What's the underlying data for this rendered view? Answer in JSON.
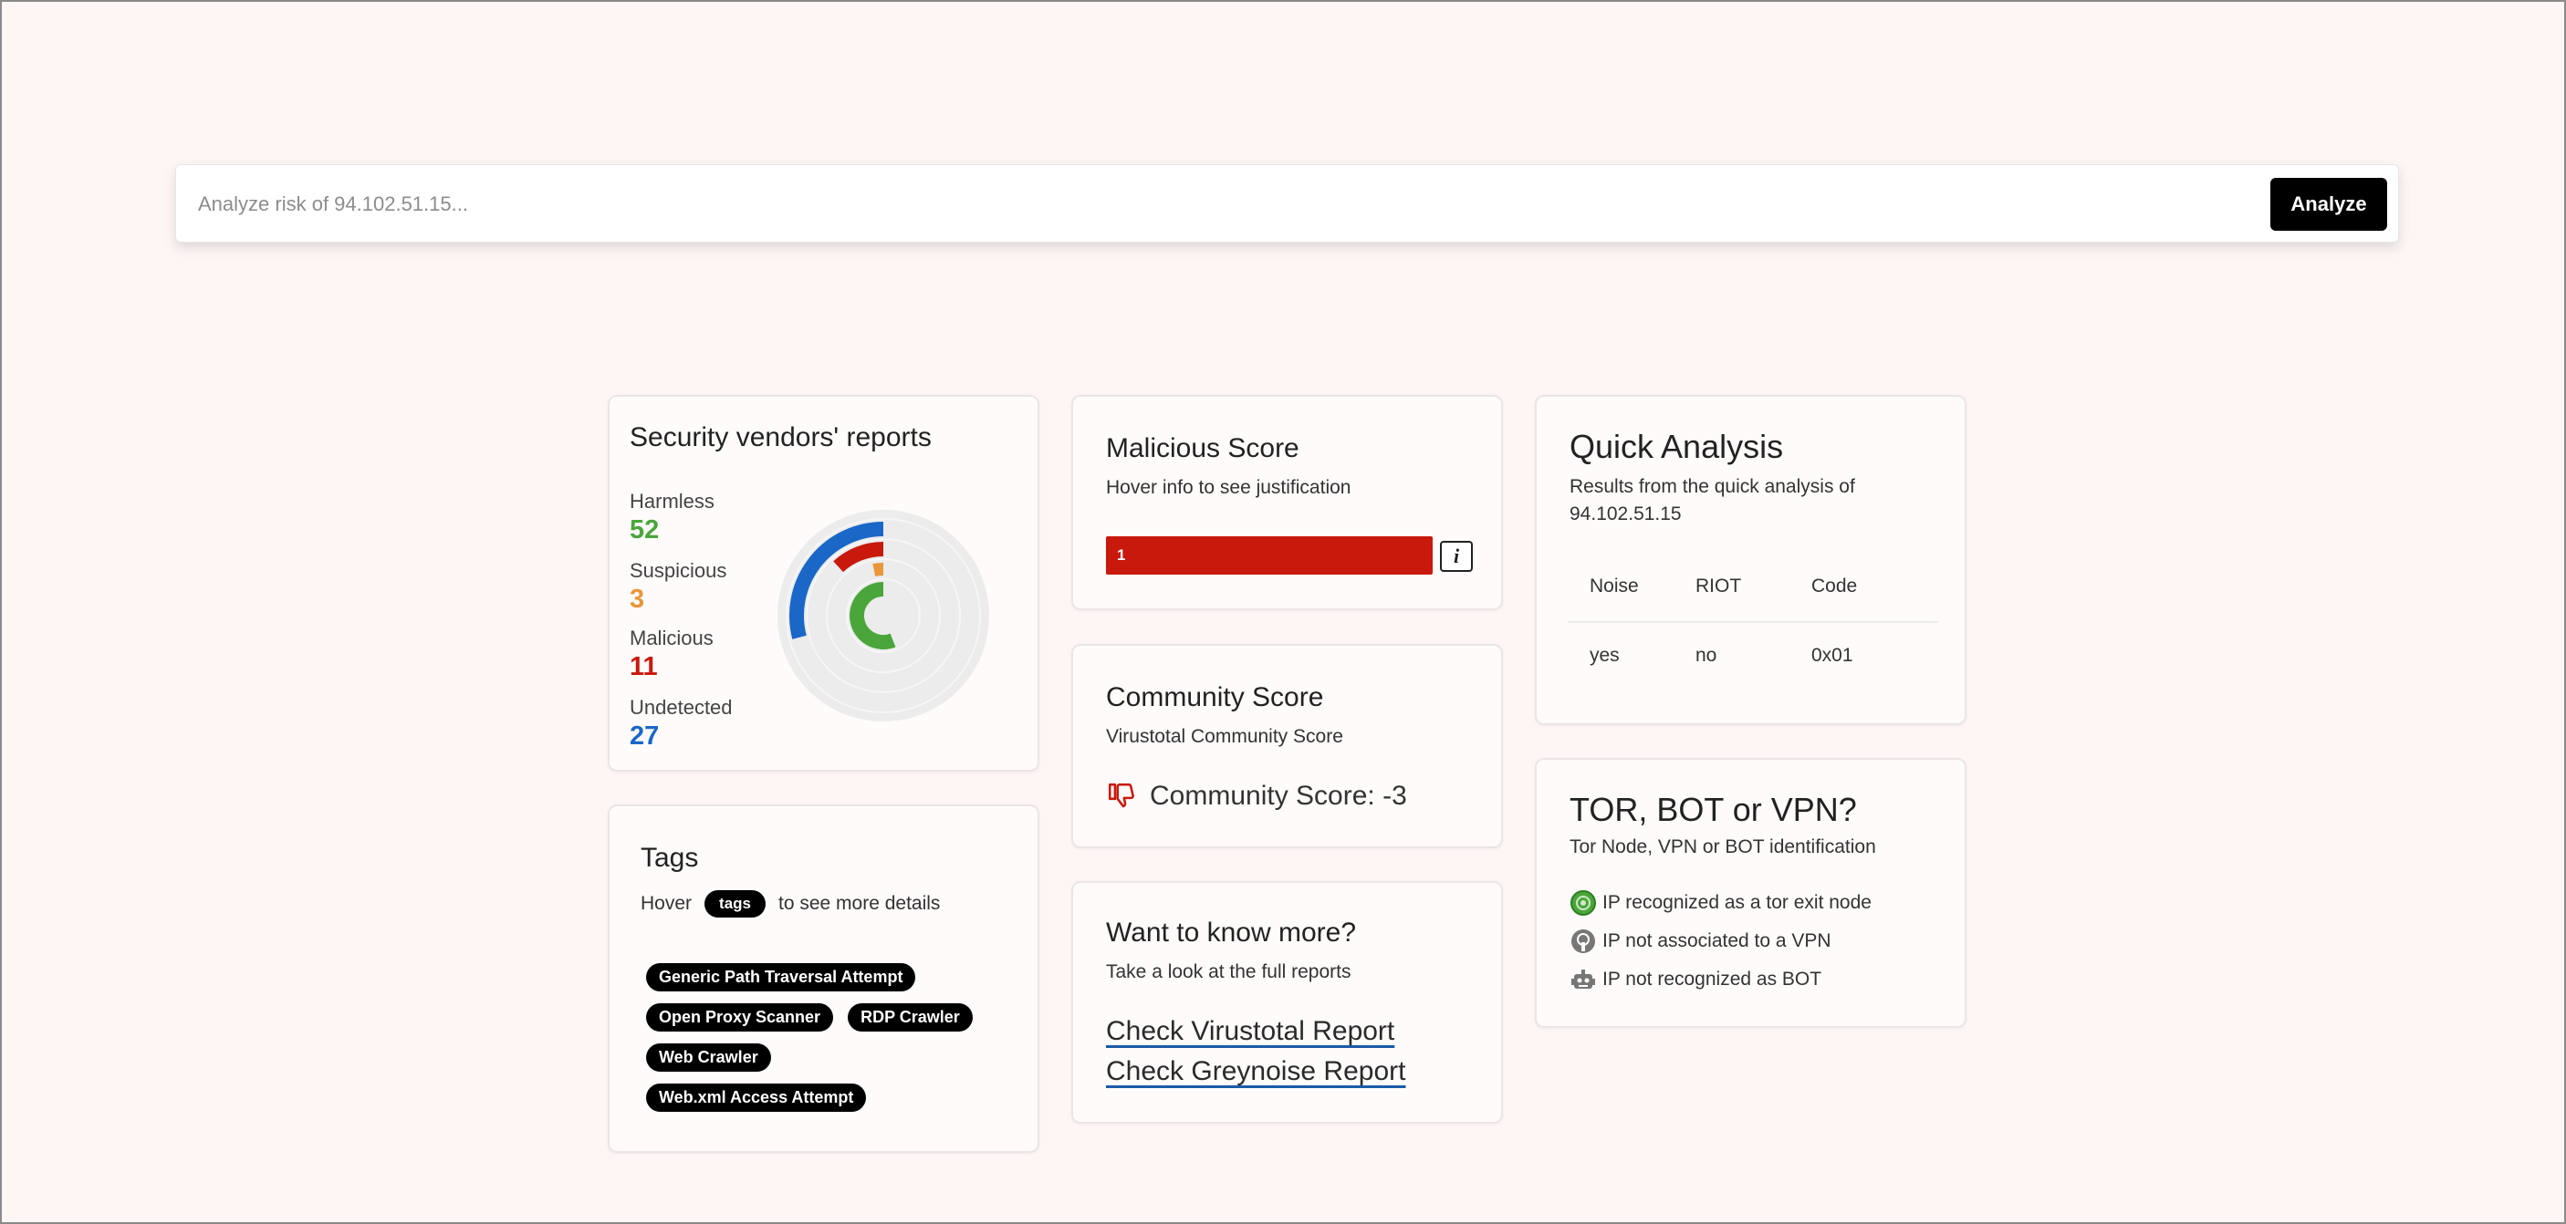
{
  "search": {
    "placeholder": "Analyze risk of 94.102.51.15...",
    "button_label": "Analyze"
  },
  "vendors": {
    "title": "Security vendors' reports",
    "stats": [
      {
        "label": "Harmless",
        "value": "52",
        "color": "#4aa63a"
      },
      {
        "label": "Suspicious",
        "value": "3",
        "color": "#e8963a"
      },
      {
        "label": "Malicious",
        "value": "11",
        "color": "#c8190c"
      },
      {
        "label": "Undetected",
        "value": "27",
        "color": "#1a67c8"
      }
    ]
  },
  "malicious": {
    "title": "Malicious Score",
    "subtitle": "Hover info to see justification",
    "value": "1",
    "info_icon": "i",
    "bar_color": "#c8190c"
  },
  "community": {
    "title": "Community Score",
    "subtitle": "Virustotal Community Score",
    "score_text": "Community Score: -3",
    "icon": "thumbs-down-icon"
  },
  "want": {
    "title": "Want to know more?",
    "subtitle": "Take a look at the full reports",
    "links": [
      "Check Virustotal Report",
      "Check Greynoise Report"
    ]
  },
  "quick": {
    "title": "Quick Analysis",
    "subtitle": "Results from the quick analysis of 94.102.51.15",
    "columns": [
      "Noise",
      "RIOT",
      "Code"
    ],
    "row": [
      "yes",
      "no",
      "0x01"
    ]
  },
  "tor": {
    "title": "TOR, BOT or VPN?",
    "subtitle": "Tor Node, VPN or BOT identification",
    "items": [
      {
        "text": "IP recognized as a tor exit node",
        "icon": "tor-icon"
      },
      {
        "text": "IP not associated to a VPN",
        "icon": "vpn-icon"
      },
      {
        "text": "IP not recognized as BOT",
        "icon": "robot-icon"
      }
    ]
  },
  "tags": {
    "title": "Tags",
    "hover_prefix": "Hover",
    "hover_pill": "tags",
    "hover_suffix": "to see more details",
    "items": [
      "Generic Path Traversal Attempt",
      "Open Proxy Scanner",
      "RDP Crawler",
      "Web Crawler",
      "Web.xml Access Attempt"
    ]
  }
}
